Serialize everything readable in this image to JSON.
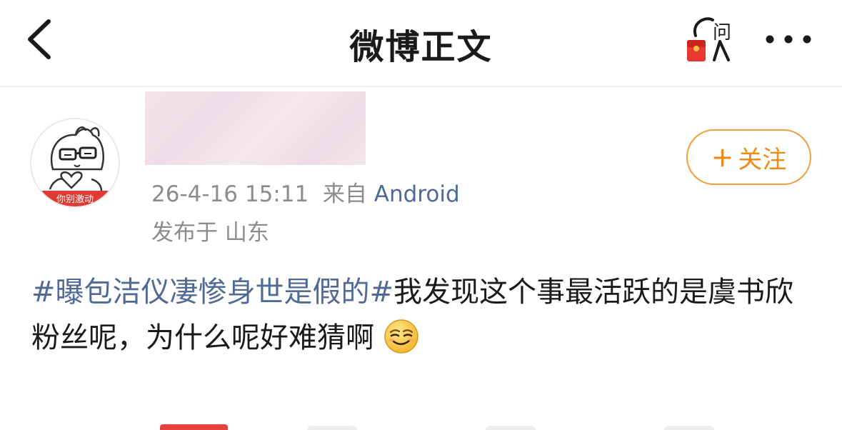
{
  "nav": {
    "title": "微博正文",
    "back_icon": "chevron-left-icon",
    "ask_icon": "red-packet-ask-icon",
    "ask_label": "问",
    "more_icon": "more-dots-icon"
  },
  "author": {
    "avatar_caption": "你别激动",
    "timestamp": "26-4-16 15:11",
    "source_prefix": "来自",
    "source": "Android",
    "location": "发布于 山东",
    "follow_label": "关注"
  },
  "post": {
    "hashtag": "#曝包洁仪凄惨身世是假的#",
    "text": "我发现这个事最活跃的是虞书欣粉丝呢，为什么呢好难猜啊",
    "emoji": "smirk-emoji"
  },
  "colors": {
    "link_blue": "#4f6a95",
    "accent_orange": "#f08a17",
    "meta_grey": "#8c8c8c"
  }
}
